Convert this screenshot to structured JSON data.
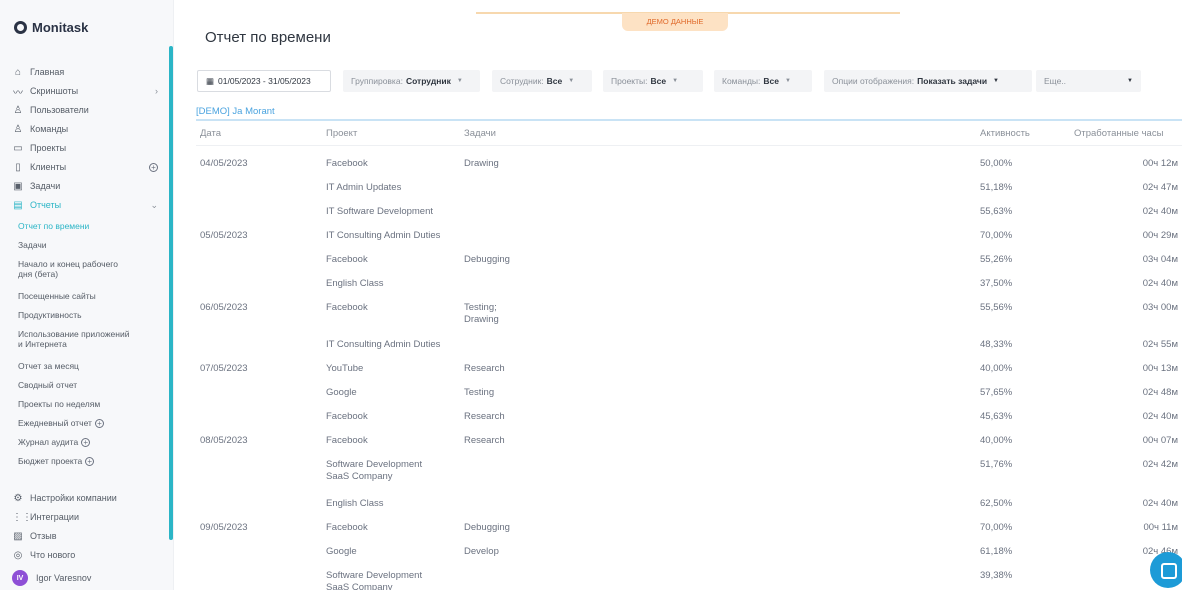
{
  "brand": {
    "name": "Monitask"
  },
  "demo_badge": "ДЕМО ДАННЫЕ",
  "page_title": "Отчет по времени",
  "sidebar": {
    "items": [
      {
        "label": "Главная",
        "icon": "home-icon"
      },
      {
        "label": "Скриншоты",
        "icon": "trend-icon",
        "trail": "›"
      },
      {
        "label": "Пользователи",
        "icon": "user-icon"
      },
      {
        "label": "Команды",
        "icon": "team-icon"
      },
      {
        "label": "Проекты",
        "icon": "folder-icon"
      },
      {
        "label": "Клиенты",
        "icon": "client-icon",
        "trail": "+"
      },
      {
        "label": "Задачи",
        "icon": "task-icon"
      },
      {
        "label": "Отчеты",
        "icon": "report-icon",
        "trail": "⌄"
      }
    ],
    "reports_sub": [
      "Отчет по времени",
      "Задачи",
      "Начало и конец рабочего",
      "дня (бета)",
      "Посещенные сайты",
      "Продуктивность",
      "Использование приложений",
      "и Интернета",
      "Отчет за месяц",
      "Сводный отчет",
      "Проекты по неделям",
      "Ежедневный отчет",
      "Журнал аудита",
      "Бюджет проекта"
    ],
    "bottom": [
      {
        "label": "Настройки компании",
        "icon": "settings-icon"
      },
      {
        "label": "Интеграции",
        "icon": "grid-icon"
      },
      {
        "label": "Отзыв",
        "icon": "feedback-icon"
      },
      {
        "label": "Что нового",
        "icon": "info-icon"
      }
    ],
    "user": {
      "initials": "IV",
      "name": "Igor Varesnov"
    }
  },
  "filters": {
    "date": "01/05/2023 - 31/05/2023",
    "grouping_label": "Группировка:",
    "grouping_value": "Сотрудник",
    "employee_label": "Сотрудник:",
    "employee_value": "Все",
    "projects_label": "Проекты:",
    "projects_value": "Все",
    "teams_label": "Команды:",
    "teams_value": "Все",
    "display_label": "Опции отображения:",
    "display_value": "Показать задачи",
    "more_label": "Еще.."
  },
  "table": {
    "group": "[DEMO] Ja Morant",
    "headers": [
      "Дата",
      "Проект",
      "Задачи",
      "Активность",
      "Отработанные часы"
    ],
    "rows": [
      {
        "date": "04/05/2023",
        "project": "Facebook",
        "task": "Drawing",
        "activity": "50,00%",
        "hours": "00ч 12м"
      },
      {
        "date": "",
        "project": "IT Admin Updates",
        "task": "",
        "activity": "51,18%",
        "hours": "02ч 47м"
      },
      {
        "date": "",
        "project": "IT Software Development",
        "task": "",
        "activity": "55,63%",
        "hours": "02ч 40м"
      },
      {
        "date": "05/05/2023",
        "project": "IT Consulting Admin Duties",
        "task": "",
        "activity": "70,00%",
        "hours": "00ч 29м"
      },
      {
        "date": "",
        "project": "Facebook",
        "task": "Debugging",
        "activity": "55,26%",
        "hours": "03ч 04м"
      },
      {
        "date": "",
        "project": "English Class",
        "task": "",
        "activity": "37,50%",
        "hours": "02ч 40м"
      },
      {
        "date": "06/05/2023",
        "project": "Facebook",
        "task": "Testing;",
        "task2": "Drawing",
        "activity": "55,56%",
        "hours": "03ч 00м"
      },
      {
        "date": "",
        "project": "IT Consulting Admin Duties",
        "task": "",
        "activity": "48,33%",
        "hours": "02ч 55м"
      },
      {
        "date": "07/05/2023",
        "project": "YouTube",
        "task": "Research",
        "activity": "40,00%",
        "hours": "00ч 13м"
      },
      {
        "date": "",
        "project": "Google",
        "task": "Testing",
        "activity": "57,65%",
        "hours": "02ч 48м"
      },
      {
        "date": "",
        "project": "Facebook",
        "task": "Research",
        "activity": "45,63%",
        "hours": "02ч 40м"
      },
      {
        "date": "08/05/2023",
        "project": "Facebook",
        "task": "Research",
        "activity": "40,00%",
        "hours": "00ч 07м"
      },
      {
        "date": "",
        "project": "Software Development",
        "project2": "SaaS Company",
        "task": "",
        "activity": "51,76%",
        "hours": "02ч 42м"
      },
      {
        "date": "",
        "project": "English Class",
        "task": "",
        "activity": "62,50%",
        "hours": "02ч 40м"
      },
      {
        "date": "09/05/2023",
        "project": "Facebook",
        "task": "Debugging",
        "activity": "70,00%",
        "hours": "00ч 11м"
      },
      {
        "date": "",
        "project": "Google",
        "task": "Develop",
        "activity": "61,18%",
        "hours": "02ч 46м"
      },
      {
        "date": "",
        "project": "Software Development",
        "project2": "SaaS Company",
        "task": "",
        "activity": "39,38%",
        "hours": "02ч"
      }
    ]
  }
}
